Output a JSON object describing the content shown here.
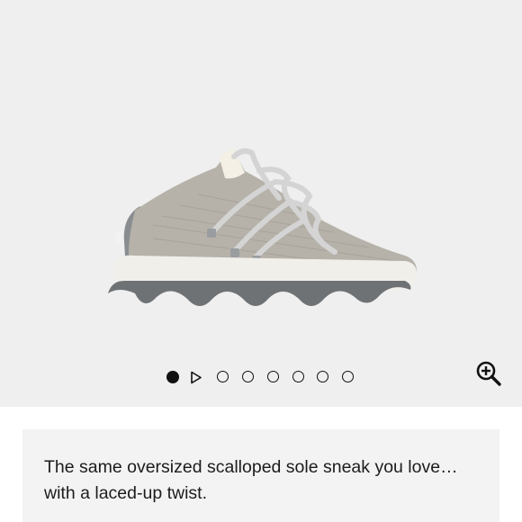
{
  "gallery": {
    "background": "#efefef",
    "image_subject": "sneaker-grey-knit-laced",
    "slide_count": 8,
    "active_slide": 1,
    "has_video_slide": true,
    "zoom_icon": "zoom-in-icon"
  },
  "description": {
    "text": "The same oversized scalloped sole sneak you love… with a laced-up twist."
  }
}
